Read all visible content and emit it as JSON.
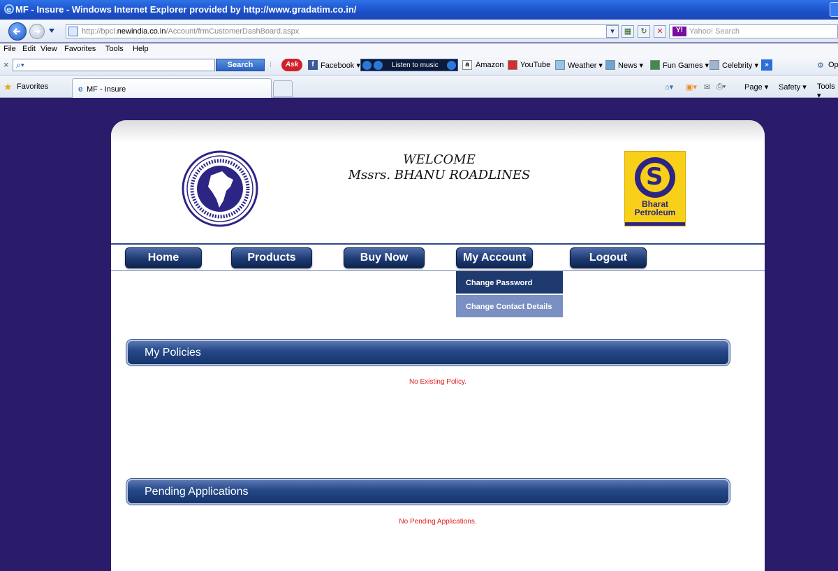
{
  "browser": {
    "window_title": "MF - Insure - Windows Internet Explorer provided by http://www.gradatim.co.in/",
    "url_prefix": "http://bpcl.",
    "url_domain": "newindia.co.in",
    "url_path": "/Account/frmCustomerDashBoard.aspx",
    "search_placeholder": "Yahoo! Search",
    "menu": [
      "File",
      "Edit",
      "View",
      "Favorites",
      "Tools",
      "Help"
    ],
    "toolbar": {
      "search_button": "Search",
      "ask": "Ask",
      "facebook": "Facebook ▾",
      "music": "Listen to music",
      "amazon": "Amazon",
      "youtube": "YouTube",
      "weather": "Weather ▾",
      "news": "News ▾",
      "games": "Fun Games ▾",
      "celebrity": "Celebrity ▾",
      "overflow": "»",
      "op": "Op"
    },
    "favorites_label": "Favorites",
    "tab_title": "MF - Insure",
    "command_bar": [
      "Page ▾",
      "Safety ▾",
      "Tools ▾"
    ]
  },
  "page": {
    "welcome_line1": "WELCOME",
    "welcome_line2": "Mssrs. BHANU ROADLINES",
    "bp_logo_text": "Bharat Petroleum",
    "nav": [
      "Home",
      "Products",
      "Buy Now",
      "My Account",
      "Logout"
    ],
    "submenu": [
      "Change Password",
      "Change Contact Details"
    ],
    "policies_title": "My Policies",
    "policies_message": "No Existing Policy.",
    "pending_title": "Pending Applications",
    "pending_message": "No Pending Applications."
  },
  "colors": {
    "page_background": "#2b1b6b",
    "nav_button": "#1d3a72",
    "submenu_active": "#1f3a6e",
    "submenu_inactive": "#7a90c3",
    "message_red": "#e02020",
    "bp_yellow": "#f8d01a",
    "bp_blue": "#2d2584"
  }
}
